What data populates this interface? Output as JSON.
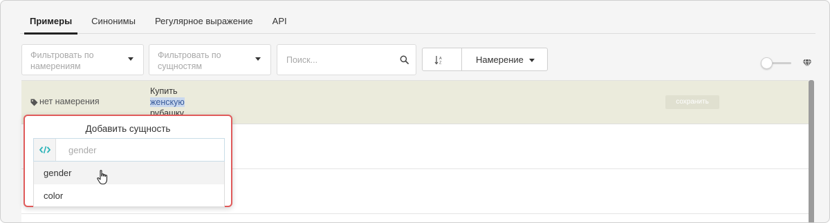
{
  "tabs": [
    {
      "label": "Примеры",
      "active": true
    },
    {
      "label": "Синонимы",
      "active": false
    },
    {
      "label": "Регулярное выражение",
      "active": false
    },
    {
      "label": "API",
      "active": false
    }
  ],
  "filters": {
    "intent_placeholder": "Фильтровать по намерениям",
    "entity_placeholder": "Фильтровать по сущностям",
    "search_placeholder": "Поиск...",
    "sort_label": "Намерение"
  },
  "rows": [
    {
      "intent": "нет намерения",
      "utterance_line1": "Купить",
      "utterance_highlight": "женскую",
      "utterance_line3": "рубашку",
      "save_label": "сохранить"
    }
  ],
  "popover": {
    "title": "Добавить сущность",
    "input_placeholder": "gender",
    "options": [
      "gender",
      "color"
    ]
  },
  "colors": {
    "highlight_row": "#ebebdc",
    "popover_border": "#e05a5a",
    "code_icon": "#2bb3b8"
  },
  "icons": [
    "search-icon",
    "sort-icon",
    "tag-icon",
    "code-icon",
    "diamond-icon",
    "hand-cursor-icon"
  ]
}
